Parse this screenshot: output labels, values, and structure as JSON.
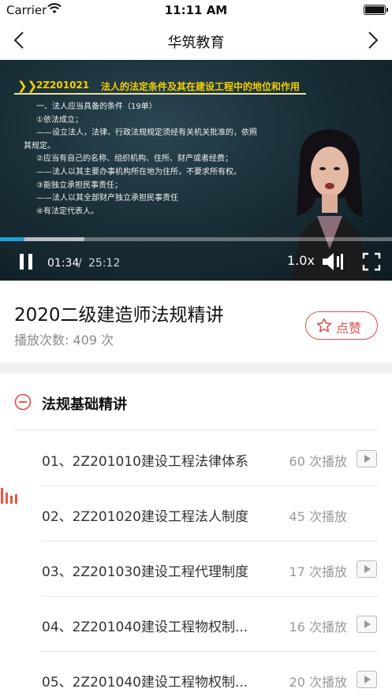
{
  "status_bar": {
    "carrier": "Carrier",
    "time": "11:11 AM"
  },
  "nav": {
    "title": "华筑教育",
    "back_icon": "chevron-left-icon",
    "forward_icon": "chevron-right-icon"
  },
  "video": {
    "slide": {
      "code": "2Z201021",
      "title": "法人的法定条件及其在建设工程中的地位和作用",
      "lines": [
        "一、法人应当具备的条件（19单）",
        "①依法成立；",
        "——设立法人，法律、行政法规规定须经有关机关批准的，依照",
        "其规定。",
        "②应当有自己的名称、组织机构、住所、财产或者经费；",
        "——法人以其主要办事机构所在地为住所，不要求所有权。",
        "③能独立承担民事责任；",
        "——法人以其全部财产独立承担民事责任",
        "④有法定代表人。"
      ]
    },
    "current_time": "01:34",
    "time_separator": "/",
    "total_time": "25:12",
    "speed": "1.0x",
    "progress": 0.062,
    "buffered": 0.215,
    "colors": {
      "progress": "#1ea1d8",
      "slide_title": "#f5d000"
    }
  },
  "course": {
    "title": "2020二级建造师法规精讲",
    "play_count_label": "播放次数: 409 次",
    "like_label": "点赞",
    "accent": "#e04b4b"
  },
  "chapter": {
    "title": "法规基础精讲",
    "toggle_icon": "minus-circle-icon"
  },
  "lessons": [
    {
      "title": "01、2Z201010建设工程法律体系",
      "plays": "60 次播放",
      "state": "play"
    },
    {
      "title": "02、2Z201020建设工程法人制度",
      "plays": "45 次播放",
      "state": "playing"
    },
    {
      "title": "03、2Z201030建设工程代理制度",
      "plays": "17 次播放",
      "state": "play"
    },
    {
      "title": "04、2Z201040建设工程物权制...",
      "plays": "16 次播放",
      "state": "play"
    },
    {
      "title": "05、2Z201040建设工程物权制...",
      "plays": "20 次播放",
      "state": "play"
    }
  ]
}
